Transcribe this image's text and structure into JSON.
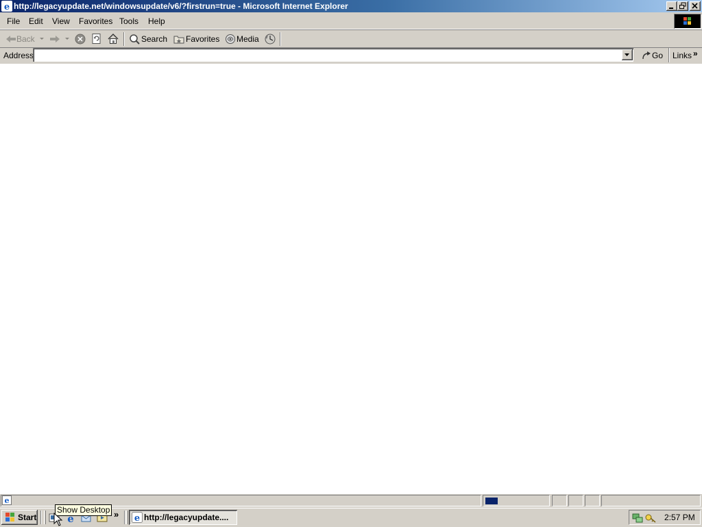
{
  "window": {
    "title": "http://legacyupdate.net/windowsupdate/v6/?firstrun=true - Microsoft Internet Explorer"
  },
  "menu": {
    "items": [
      "File",
      "Edit",
      "View",
      "Favorites",
      "Tools",
      "Help"
    ]
  },
  "toolbar": {
    "back_label": "Back",
    "search_label": "Search",
    "favorites_label": "Favorites",
    "media_label": "Media"
  },
  "address_bar": {
    "label": "Address",
    "value": "",
    "go_label": "Go",
    "links_label": "Links",
    "chevron": "»"
  },
  "status_bar": {
    "text": ""
  },
  "taskbar": {
    "start_label": "Start",
    "quicklaunch_chevron": "»",
    "tooltip": "Show Desktop",
    "task_label": "http://legacyupdate....",
    "clock": "2:57 PM"
  },
  "colors": {
    "title_start": "#0a246a",
    "title_end": "#a6caf0",
    "face": "#d4d0c8",
    "progress": "#0a246a"
  }
}
